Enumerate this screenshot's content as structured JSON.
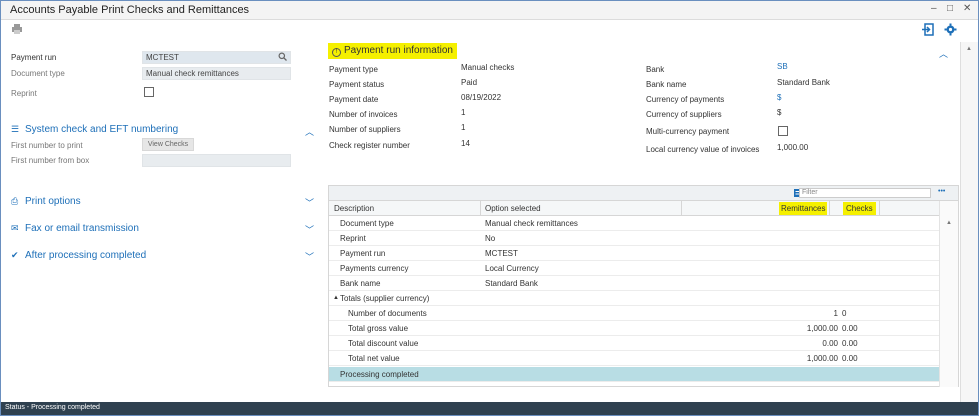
{
  "window": {
    "title": "Accounts Payable Print Checks and Remittances",
    "minimize": "–",
    "maximize": "□",
    "close": "✕"
  },
  "toolbar": {
    "print_icon": "printer-icon",
    "exit_icon": "exit-icon",
    "settings_icon": "gear-icon"
  },
  "left": {
    "payment_run": {
      "label": "Payment run",
      "value": "MCTEST"
    },
    "document_type": {
      "label": "Document type",
      "value": "Manual check remittances"
    },
    "reprint": {
      "label": "Reprint"
    },
    "system_check": {
      "title": "System check and EFT numbering",
      "first_number_label": "First number to print",
      "view_checks_label": "View Checks",
      "first_number_box_label": "First number from box"
    },
    "sections": {
      "print_options": "Print options",
      "fax_email": "Fax or email transmission",
      "after_processing": "After processing completed"
    }
  },
  "right": {
    "header": "Payment run information",
    "info_left": [
      {
        "label": "Payment type",
        "value": "Manual checks"
      },
      {
        "label": "Payment status",
        "value": "Paid"
      },
      {
        "label": "Payment date",
        "value": "08/19/2022"
      },
      {
        "label": "Number of invoices",
        "value": "1"
      },
      {
        "label": "Number of suppliers",
        "value": "1"
      },
      {
        "label": "Check register number",
        "value": "14"
      }
    ],
    "info_right": [
      {
        "label": "Bank",
        "value": "SB"
      },
      {
        "label": "Bank name",
        "value": "Standard Bank"
      },
      {
        "label": "Currency of payments",
        "value": "$"
      },
      {
        "label": "Currency of suppliers",
        "value": "$"
      },
      {
        "label": "Multi-currency payment",
        "value": ""
      },
      {
        "label": "Local currency value of invoices",
        "value": "1,000.00"
      }
    ],
    "grid": {
      "filter_placeholder": "Filter",
      "more": "•••",
      "columns": {
        "description": "Description",
        "option": "Option selected",
        "remittances": "Remittances",
        "checks": "Checks"
      },
      "rows": [
        {
          "description": "Document type",
          "option": "Manual check remittances",
          "rem": "",
          "chk": ""
        },
        {
          "description": "Reprint",
          "option": "No",
          "rem": "",
          "chk": ""
        },
        {
          "description": "Payment run",
          "option": "MCTEST",
          "rem": "",
          "chk": ""
        },
        {
          "description": "Payments currency",
          "option": "Local Currency",
          "rem": "",
          "chk": ""
        },
        {
          "description": "Bank name",
          "option": "Standard Bank",
          "rem": "",
          "chk": ""
        }
      ],
      "group": "Totals (supplier currency)",
      "totals": [
        {
          "description": "Number of documents",
          "rem": "1",
          "chk": "0"
        },
        {
          "description": "Total gross value",
          "rem": "1,000.00",
          "chk": "0.00"
        },
        {
          "description": "Total discount value",
          "rem": "0.00",
          "chk": "0.00"
        },
        {
          "description": "Total net value",
          "rem": "1,000.00",
          "chk": "0.00"
        }
      ],
      "done": "Processing completed"
    }
  },
  "status": {
    "text": "Status - Processing completed"
  },
  "colors": {
    "accent": "#1d6fb8",
    "highlight": "#f5f000",
    "status_bg": "#2f4150",
    "done_row": "#b8dde4"
  }
}
